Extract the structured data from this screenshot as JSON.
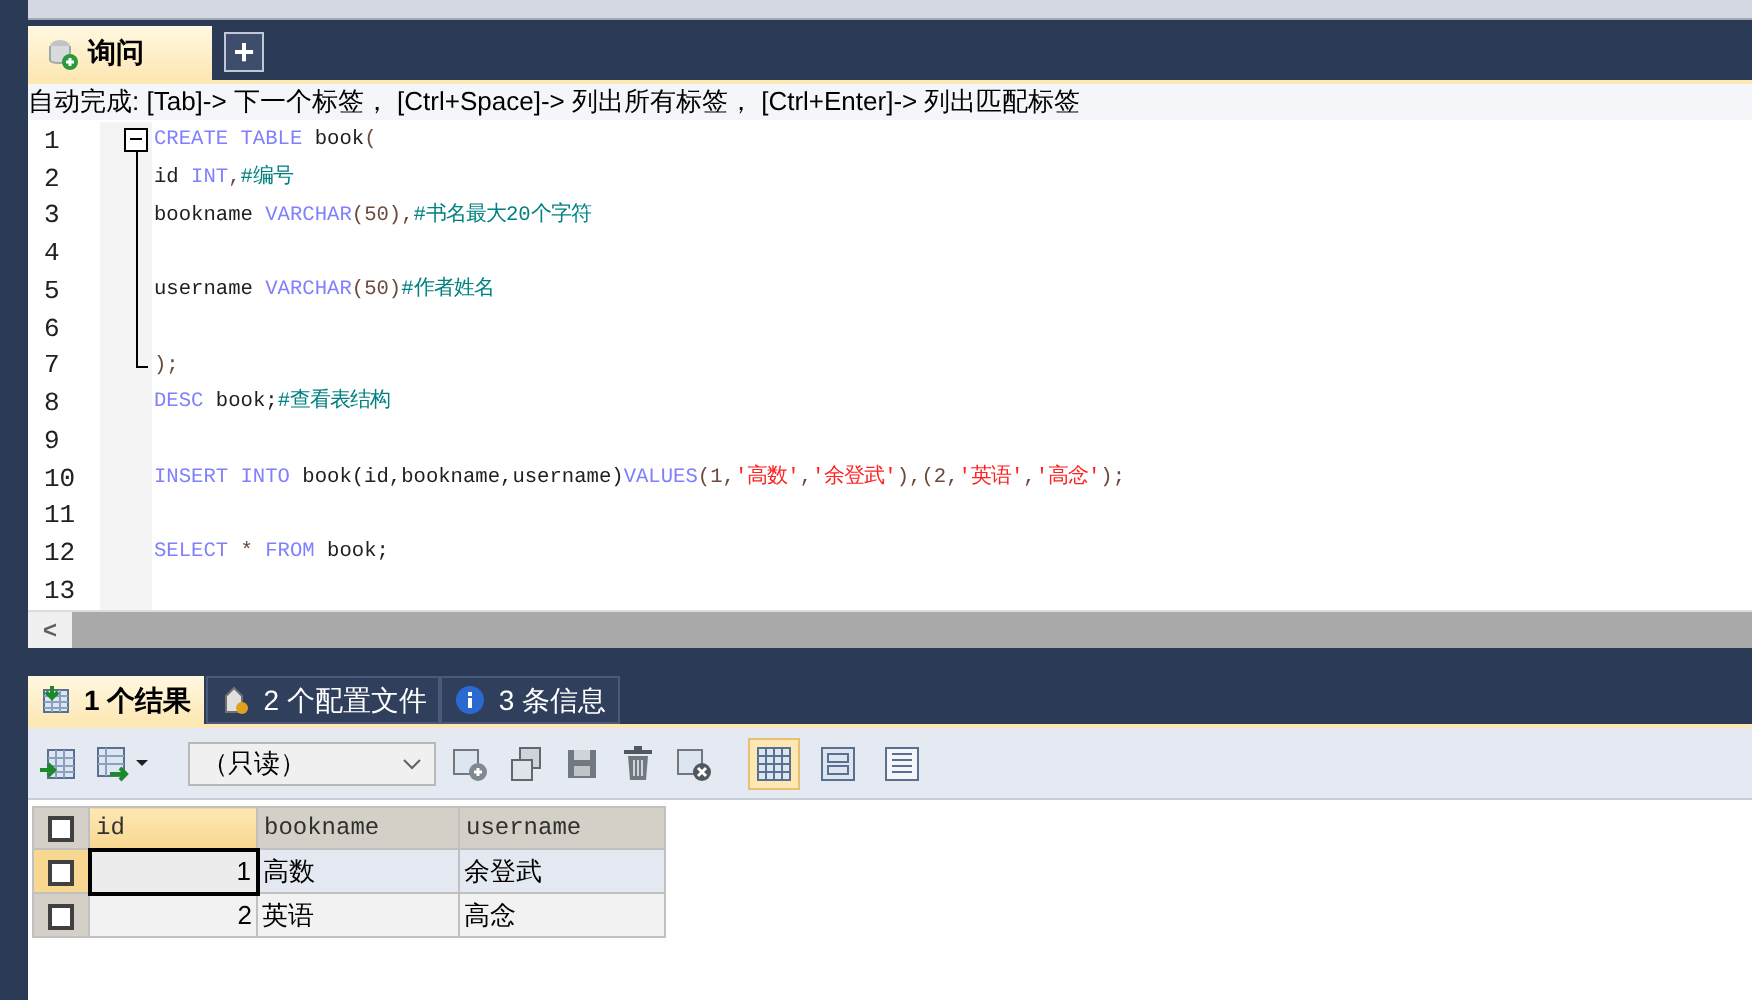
{
  "query_tabs": [
    {
      "label": "询问",
      "selected": true
    }
  ],
  "new_tab_button": "+",
  "autocomplete_hint": "自动完成: [Tab]-> 下一个标签， [Ctrl+Space]-> 列出所有标签， [Ctrl+Enter]-> 列出匹配标签",
  "editor": {
    "lines": [
      {
        "number": "1",
        "kind": "foldstart",
        "tokens": [
          {
            "kind": "keyword",
            "text": "CREATE TABLE "
          },
          {
            "kind": "plain",
            "text": "book"
          },
          {
            "kind": "punct",
            "text": "("
          }
        ]
      },
      {
        "number": "2",
        "kind": "folded",
        "tokens": [
          {
            "kind": "plain",
            "text": "id "
          },
          {
            "kind": "keyword",
            "text": "INT"
          },
          {
            "kind": "punct",
            "text": ","
          },
          {
            "kind": "comment",
            "text": "#编号"
          }
        ]
      },
      {
        "number": "3",
        "kind": "folded",
        "tokens": [
          {
            "kind": "plain",
            "text": "bookname "
          },
          {
            "kind": "keyword",
            "text": "VARCHAR"
          },
          {
            "kind": "punct",
            "text": "(50),"
          },
          {
            "kind": "comment",
            "text": "#书名最大20个字符"
          }
        ]
      },
      {
        "number": "4",
        "kind": "folded"
      },
      {
        "number": "5",
        "kind": "folded",
        "tokens": [
          {
            "kind": "plain",
            "text": "username "
          },
          {
            "kind": "keyword",
            "text": "VARCHAR"
          },
          {
            "kind": "punct",
            "text": "(50)"
          },
          {
            "kind": "comment",
            "text": "#作者姓名"
          }
        ]
      },
      {
        "number": "6",
        "kind": "folded"
      },
      {
        "number": "7",
        "kind": "foldend",
        "tokens": [
          {
            "kind": "punct",
            "text": ");"
          }
        ]
      },
      {
        "number": "8",
        "kind": "plain",
        "tokens": [
          {
            "kind": "keyword",
            "text": "DESC "
          },
          {
            "kind": "plain",
            "text": "book;"
          },
          {
            "kind": "comment",
            "text": "#查看表结构"
          }
        ]
      },
      {
        "number": "9",
        "kind": "plain"
      },
      {
        "number": "10",
        "kind": "plain",
        "tokens": [
          {
            "kind": "keyword",
            "text": "INSERT INTO "
          },
          {
            "kind": "plain",
            "text": "book(id,bookname,username)"
          },
          {
            "kind": "keyword",
            "text": "VALUES"
          },
          {
            "kind": "punct",
            "text": "(1,"
          },
          {
            "kind": "string",
            "text": "'高数'"
          },
          {
            "kind": "punct",
            "text": ","
          },
          {
            "kind": "string",
            "text": "'余登武'"
          },
          {
            "kind": "punct",
            "text": "),(2,"
          },
          {
            "kind": "string",
            "text": "'英语'"
          },
          {
            "kind": "punct",
            "text": ","
          },
          {
            "kind": "string",
            "text": "'高念'"
          },
          {
            "kind": "punct",
            "text": ");"
          }
        ]
      },
      {
        "number": "11",
        "kind": "plain"
      },
      {
        "number": "12",
        "kind": "plain",
        "tokens": [
          {
            "kind": "keyword",
            "text": "SELECT "
          },
          {
            "kind": "punct",
            "text": "* "
          },
          {
            "kind": "keyword",
            "text": "FROM "
          },
          {
            "kind": "plain",
            "text": "book;"
          }
        ]
      },
      {
        "number": "13",
        "kind": "plain"
      }
    ]
  },
  "scroll_left_arrow": "<",
  "result_tabs": [
    {
      "label": "1 个结果",
      "selected": true
    },
    {
      "label": "2 个配置文件",
      "selected": false
    },
    {
      "label": "3 条信息",
      "selected": false
    }
  ],
  "mode_dropdown": {
    "value": "（只读）"
  },
  "view_buttons": [
    {
      "kind": "grid",
      "selected": true
    },
    {
      "kind": "form",
      "selected": false
    },
    {
      "kind": "text",
      "selected": false
    }
  ],
  "table": {
    "all_checked": false,
    "columns": [
      "id",
      "bookname",
      "username"
    ],
    "rows": [
      {
        "selected": true,
        "checked": false,
        "cells": [
          "1",
          "高数",
          "余登武"
        ]
      },
      {
        "selected": false,
        "checked": false,
        "cells": [
          "2",
          "英语",
          "高念"
        ]
      }
    ]
  }
}
